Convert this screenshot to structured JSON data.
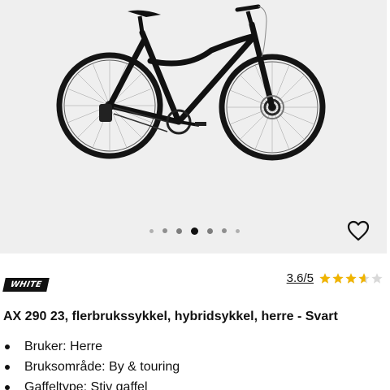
{
  "product": {
    "brand_logo": "WHITE",
    "title": "AX 290 23, flerbrukssykkel, hybridsykkel, herre - Svart",
    "rating_text": "3.6/5",
    "rating_value": 3.6,
    "rating_max": 5,
    "star_color": "#f0b400"
  },
  "gallery": {
    "image_alt": "Black hybrid bicycle",
    "active_index": 3,
    "dot_count": 7,
    "background": "#efefef"
  },
  "icons": {
    "favorite": "heart-outline-icon"
  },
  "specs": [
    {
      "text": "Bruker: Herre"
    },
    {
      "text": "Bruksområde: By & touring"
    },
    {
      "text": "Gaffeltype: Stiv gaffel"
    }
  ]
}
